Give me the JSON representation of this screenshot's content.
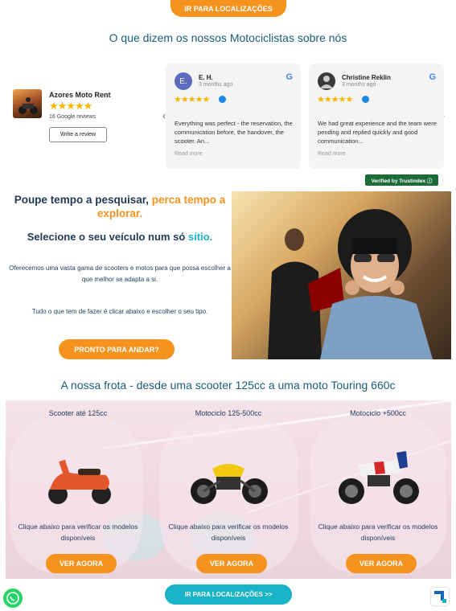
{
  "top_button": {
    "label": "IR PARA LOCALIZAÇÕES"
  },
  "reviews": {
    "heading": "O que dizem os nossos Motociclistas sobre nós",
    "business": {
      "name": "Azores Moto Rent",
      "stars": "★★★★★",
      "count_label": "16 Google reviews",
      "write_review_label": "Write a review"
    },
    "items": [
      {
        "initial": "E.",
        "name": "E. H.",
        "date": "3 months ago",
        "stars": "★★★★★",
        "text": "Everything was perfect - the reservation, the communication before, the handover, the scooter. An...",
        "read_more": "Read more",
        "avatar_color": "#5c6bc0"
      },
      {
        "initial": "",
        "name": "Christine Reklin",
        "date": "3 months ago",
        "stars": "★★★★★",
        "text": "We had great experience and the team were pending and replied quickly and good communication...",
        "read_more": "Read more",
        "avatar_color": "#3a3a3a"
      }
    ],
    "verified_label": "Verified by Trustindex ⓘ",
    "prev_arrow": "‹",
    "next_arrow": "›",
    "google_glyph": "G"
  },
  "promo": {
    "title_part1": "Poupe tempo a pesquisar,",
    "title_accent": "perca tempo a explorar.",
    "subtitle_part1": "Selecione o seu veículo num só",
    "subtitle_accent": "sítio.",
    "paragraph1": "Oferecemos uma vasta gama de scooters e motos para que possa escolher a que melhor se adapta a si.",
    "paragraph2": "Tudo o que tem de fazer é clicar abaixo e escolher o seu tipo.",
    "button_label": "PRONTO PARA ANDAR?"
  },
  "fleet": {
    "heading": "A nossa frota - desde uma scooter 125cc a uma moto Touring 660c",
    "cards": [
      {
        "title": "Scooter até 125cc",
        "description": "Clique abaixo para verificar os modelos disponíveis",
        "button": "VER AGORA"
      },
      {
        "title": "Motociclo 125-500cc",
        "description": "Clique abaixo para verificar os modelos disponíveis",
        "button": "VER AGORA"
      },
      {
        "title": "Motociclo +500cc",
        "description": "Clique abaixo para verificar os modelos disponíveis",
        "button": "VER AGORA"
      }
    ]
  },
  "bottom_button": {
    "label": "IR PARA LOCALIZAÇÕES >>"
  },
  "colors": {
    "orange": "#f6921e",
    "teal": "#1ab2c6",
    "navy": "#1f3b57",
    "star": "#f7b500"
  }
}
